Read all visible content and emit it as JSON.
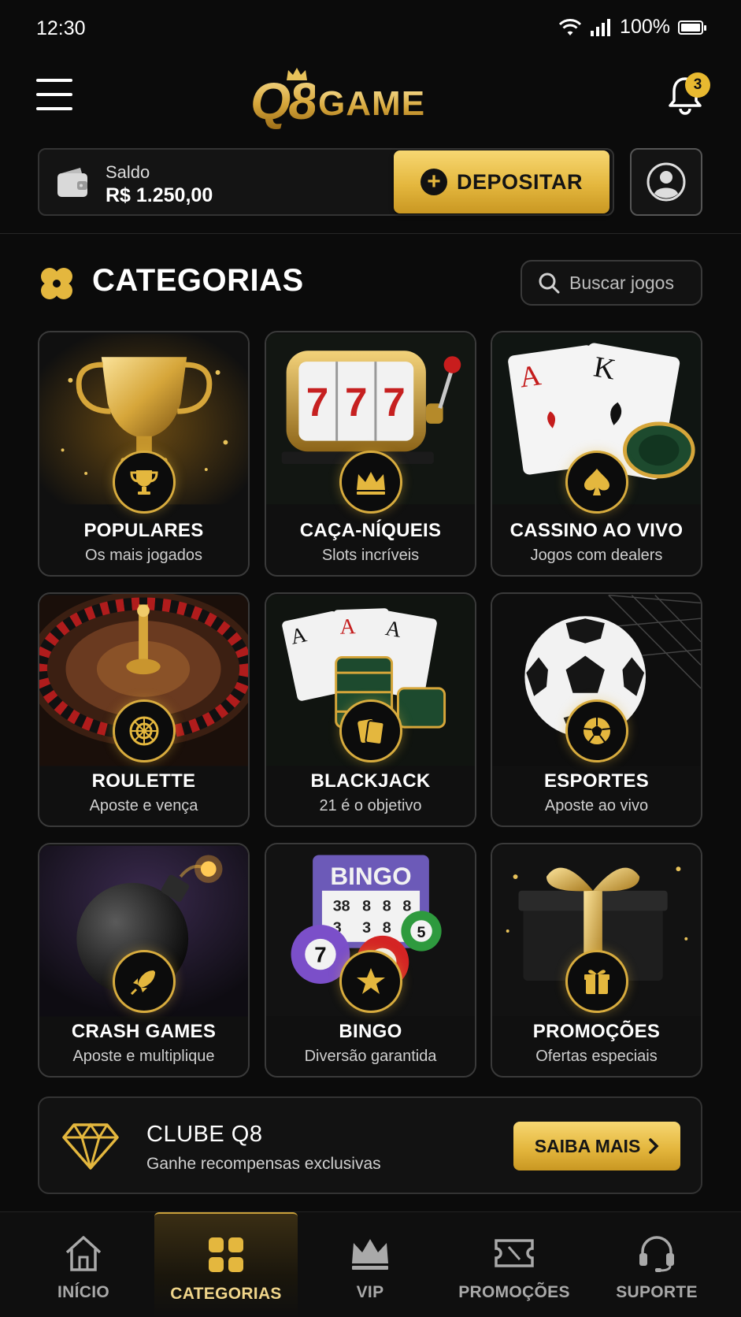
{
  "status_bar": {
    "time": "12:30",
    "battery": "100%"
  },
  "header": {
    "logo_mark": "Q8",
    "logo_text": "GAME",
    "notification_count": "3"
  },
  "balance": {
    "label": "Saldo",
    "value": "R$ 1.250,00",
    "deposit_label": "DEPOSITAR"
  },
  "section": {
    "title": "CATEGORIAS",
    "search_placeholder": "Buscar jogos"
  },
  "categories": [
    {
      "title": "POPULARES",
      "subtitle": "Os mais jogados",
      "icon": "trophy-icon"
    },
    {
      "title": "CAÇA-NÍQUEIS",
      "subtitle": "Slots incríveis",
      "icon": "crown-icon"
    },
    {
      "title": "CASSINO AO VIVO",
      "subtitle": "Jogos com dealers",
      "icon": "spade-icon"
    },
    {
      "title": "ROULETTE",
      "subtitle": "Aposte e vença",
      "icon": "roulette-wheel-icon"
    },
    {
      "title": "BLACKJACK",
      "subtitle": "21 é o objetivo",
      "icon": "cards-icon"
    },
    {
      "title": "ESPORTES",
      "subtitle": "Aposte ao vivo",
      "icon": "soccer-ball-icon"
    },
    {
      "title": "CRASH GAMES",
      "subtitle": "Aposte e multiplique",
      "icon": "rocket-icon"
    },
    {
      "title": "BINGO",
      "subtitle": "Diversão garantida",
      "icon": "star-icon"
    },
    {
      "title": "PROMOÇÕES",
      "subtitle": "Ofertas especiais",
      "icon": "gift-icon"
    }
  ],
  "art_text": {
    "slot_reels": [
      "7",
      "7",
      "7"
    ],
    "card_ranks": [
      "A",
      "K"
    ],
    "blackjack_ranks": [
      "A",
      "A",
      "A"
    ],
    "bingo_title": "BINGO",
    "bingo_numbers": [
      "38",
      "8",
      "8",
      "8",
      "3",
      "3",
      "8",
      "8"
    ],
    "bingo_balls": [
      "7",
      "5",
      "5"
    ]
  },
  "club": {
    "title": "CLUBE Q8",
    "subtitle": "Ganhe recompensas exclusivas",
    "button_label": "SAIBA MAIS"
  },
  "bottom_nav": [
    {
      "label": "INÍCIO",
      "icon": "home-icon",
      "active": false
    },
    {
      "label": "CATEGORIAS",
      "icon": "grid-icon",
      "active": true
    },
    {
      "label": "VIP",
      "icon": "crown-icon",
      "active": false
    },
    {
      "label": "PROMOÇÕES",
      "icon": "ticket-icon",
      "active": false
    },
    {
      "label": "SUPORTE",
      "icon": "headset-icon",
      "active": false
    }
  ],
  "colors": {
    "gold": "#e4b73e",
    "gold_light": "#f7d772",
    "background": "#0b0b0b",
    "card_border": "#3a3a3a"
  }
}
